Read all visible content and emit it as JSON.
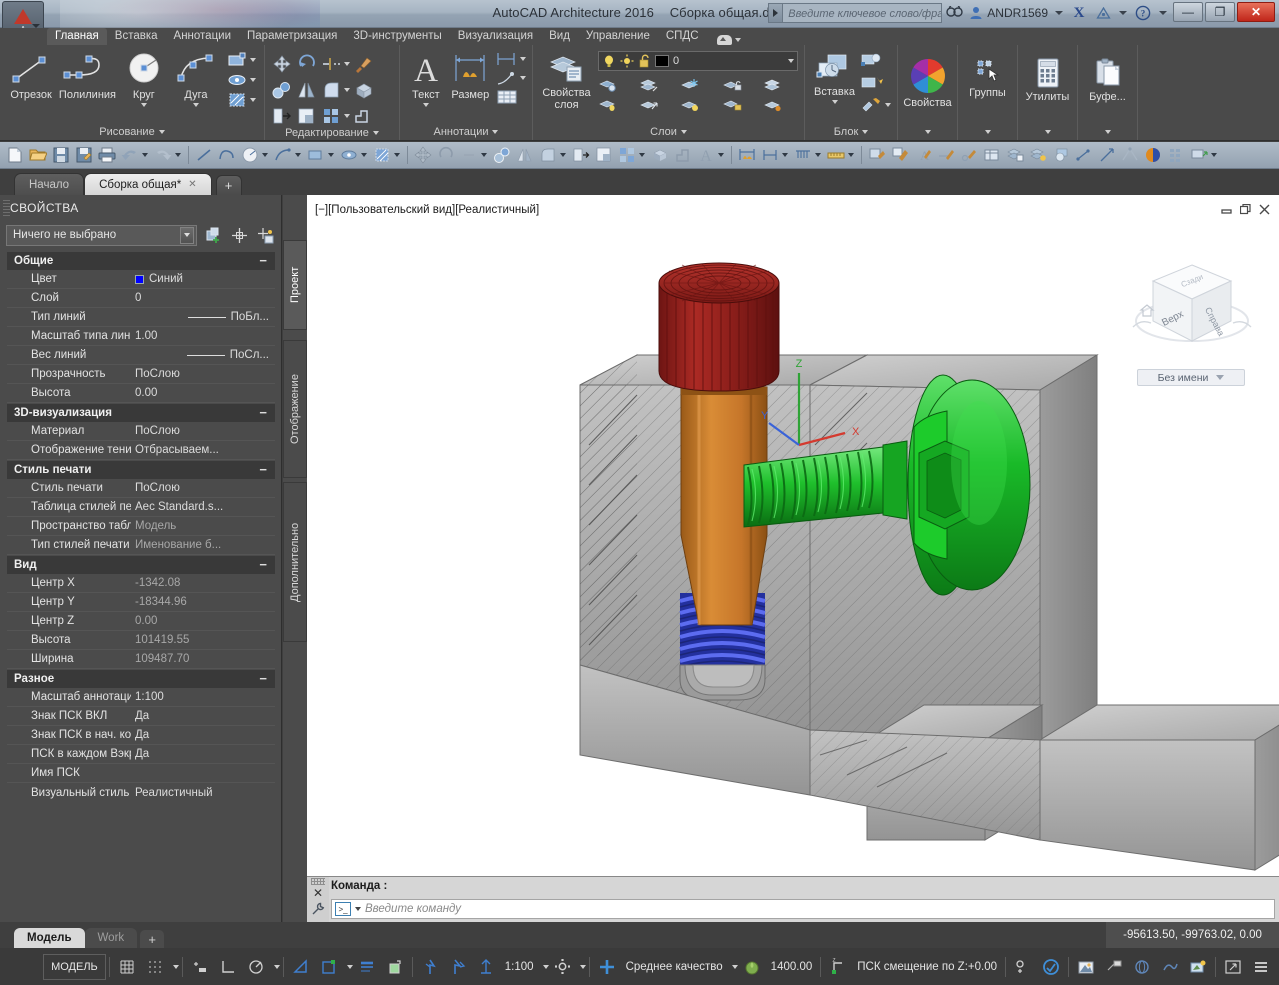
{
  "titlebar": {
    "app_title": "AutoCAD Architecture 2016",
    "document_name": "Сборка общая.dwg",
    "search_placeholder": "Введите ключевое слово/фразу",
    "user_name": "ANDR1569",
    "minimize": "—",
    "restore": "❐",
    "close": "✕"
  },
  "ribbon_tabs": [
    {
      "label": "Главная",
      "active": true
    },
    {
      "label": "Вставка",
      "active": false
    },
    {
      "label": "Аннотации",
      "active": false
    },
    {
      "label": "Параметризация",
      "active": false
    },
    {
      "label": "3D-инструменты",
      "active": false
    },
    {
      "label": "Визуализация",
      "active": false
    },
    {
      "label": "Вид",
      "active": false
    },
    {
      "label": "Управление",
      "active": false
    },
    {
      "label": "СПДС",
      "active": false
    }
  ],
  "ribbon_panels": [
    {
      "title": "Рисование",
      "buttons": [
        "Отрезок",
        "Полилиния",
        "Круг",
        "Дуга"
      ]
    },
    {
      "title": "Редактирование",
      "buttons": []
    },
    {
      "title": "Аннотации",
      "buttons": [
        "Текст",
        "Размер"
      ]
    },
    {
      "title": "Слои",
      "buttons": [
        "Свойства слоя"
      ],
      "layer_current": "0"
    },
    {
      "title": "Блок",
      "buttons": [
        "Вставка"
      ]
    },
    {
      "title": "",
      "buttons": [
        "Свойства"
      ]
    },
    {
      "title": "",
      "buttons": [
        "Группы"
      ]
    },
    {
      "title": "",
      "buttons": [
        "Утилиты"
      ]
    },
    {
      "title": "",
      "buttons": [
        "Буфе..."
      ]
    }
  ],
  "doc_tabs": [
    {
      "label": "Начало",
      "active": false,
      "closable": false
    },
    {
      "label": "Сборка общая*",
      "active": true,
      "closable": true
    }
  ],
  "doc_tab_add": "+",
  "properties": {
    "title": "СВОЙСТВА",
    "selection": "Ничего не выбрано",
    "groups": [
      {
        "name": "Общие",
        "collapse": "−",
        "rows": [
          {
            "name": "Цвет",
            "value": "Синий",
            "swatch": "#0000ff",
            "dim": false
          },
          {
            "name": "Слой",
            "value": "0",
            "dim": false
          },
          {
            "name": "Тип линий",
            "value": "ПоБл...",
            "line": true,
            "dim": false
          },
          {
            "name": "Масштаб типа линий",
            "value": "1.00",
            "dim": false
          },
          {
            "name": "Вес линий",
            "value": "ПоСл...",
            "line": true,
            "dim": false
          },
          {
            "name": "Прозрачность",
            "value": "ПоСлою",
            "dim": false
          },
          {
            "name": "Высота",
            "value": "0.00",
            "dim": false
          }
        ]
      },
      {
        "name": "3D-визуализация",
        "collapse": "−",
        "rows": [
          {
            "name": "Материал",
            "value": "ПоСлою",
            "dim": false
          },
          {
            "name": "Отображение тени",
            "value": "Отбрасываем...",
            "dim": false
          }
        ]
      },
      {
        "name": "Стиль печати",
        "collapse": "−",
        "rows": [
          {
            "name": "Стиль печати",
            "value": "ПоСлою",
            "dim": false
          },
          {
            "name": "Таблица стилей печати",
            "value": "Aec  Standard.s...",
            "dim": false
          },
          {
            "name": "Пространство таблиц...",
            "value": "Модель",
            "dim": true
          },
          {
            "name": "Тип стилей печати",
            "value": "Именование  б...",
            "dim": true
          }
        ]
      },
      {
        "name": "Вид",
        "collapse": "−",
        "rows": [
          {
            "name": "Центр X",
            "value": "-1342.08",
            "dim": true
          },
          {
            "name": "Центр Y",
            "value": "-18344.96",
            "dim": true
          },
          {
            "name": "Центр Z",
            "value": "0.00",
            "dim": true
          },
          {
            "name": "Высота",
            "value": "101419.55",
            "dim": true
          },
          {
            "name": "Ширина",
            "value": "109487.70",
            "dim": true
          }
        ]
      },
      {
        "name": "Разное",
        "collapse": "−",
        "rows": [
          {
            "name": "Масштаб аннотаций",
            "value": "1:100",
            "dim": false
          },
          {
            "name": "Знак ПСК ВКЛ",
            "value": "Да",
            "dim": false
          },
          {
            "name": "Знак ПСК в нач. коорд.",
            "value": "Да",
            "dim": false
          },
          {
            "name": "ПСК в каждом Вэкране",
            "value": "Да",
            "dim": false
          },
          {
            "name": "Имя ПСК",
            "value": "",
            "dim": false
          },
          {
            "name": "Визуальный стиль",
            "value": "Реалистичный",
            "dim": false
          }
        ]
      }
    ]
  },
  "side_tabs": [
    {
      "label": "Проект",
      "selected": true
    },
    {
      "label": "Отображение",
      "selected": false
    },
    {
      "label": "Дополнительно",
      "selected": false
    }
  ],
  "viewport": {
    "label": "[−][Пользовательский вид][Реалистичный]",
    "viewcube": {
      "top_face": "Верх",
      "right_face": "Справа",
      "back_face": "Сзади",
      "named_view": "Без имени"
    }
  },
  "command_line": {
    "history_label": "Команда :",
    "placeholder": "Введите  команду"
  },
  "layout_tabs": [
    {
      "label": "Модель",
      "active": true
    },
    {
      "label": "Work",
      "active": false
    }
  ],
  "layout_tab_add": "+",
  "coordinates": "-95613.50, -99763.02, 0.00",
  "statusbar": {
    "model_label": "МОДЕЛЬ",
    "annotation_scale": "1:100",
    "quality": "Среднее качество",
    "scale_value": "1400.00",
    "ucs_label": "ПСК смещение по Z:+0.00"
  },
  "colors": {
    "accent_blue": "#4a90d9",
    "title_gradient_top": "#b7c3cf",
    "ribbon_bg": "#4a4a4a",
    "palette_bg": "#4b4b4b",
    "viewport_bg": "#ffffff",
    "close_red": "#c0261a",
    "model_green": "#1fb52a",
    "bolt_orange": "#c87a2a",
    "cap_red": "#9e2320",
    "spring_blue": "#2a3fd0"
  }
}
